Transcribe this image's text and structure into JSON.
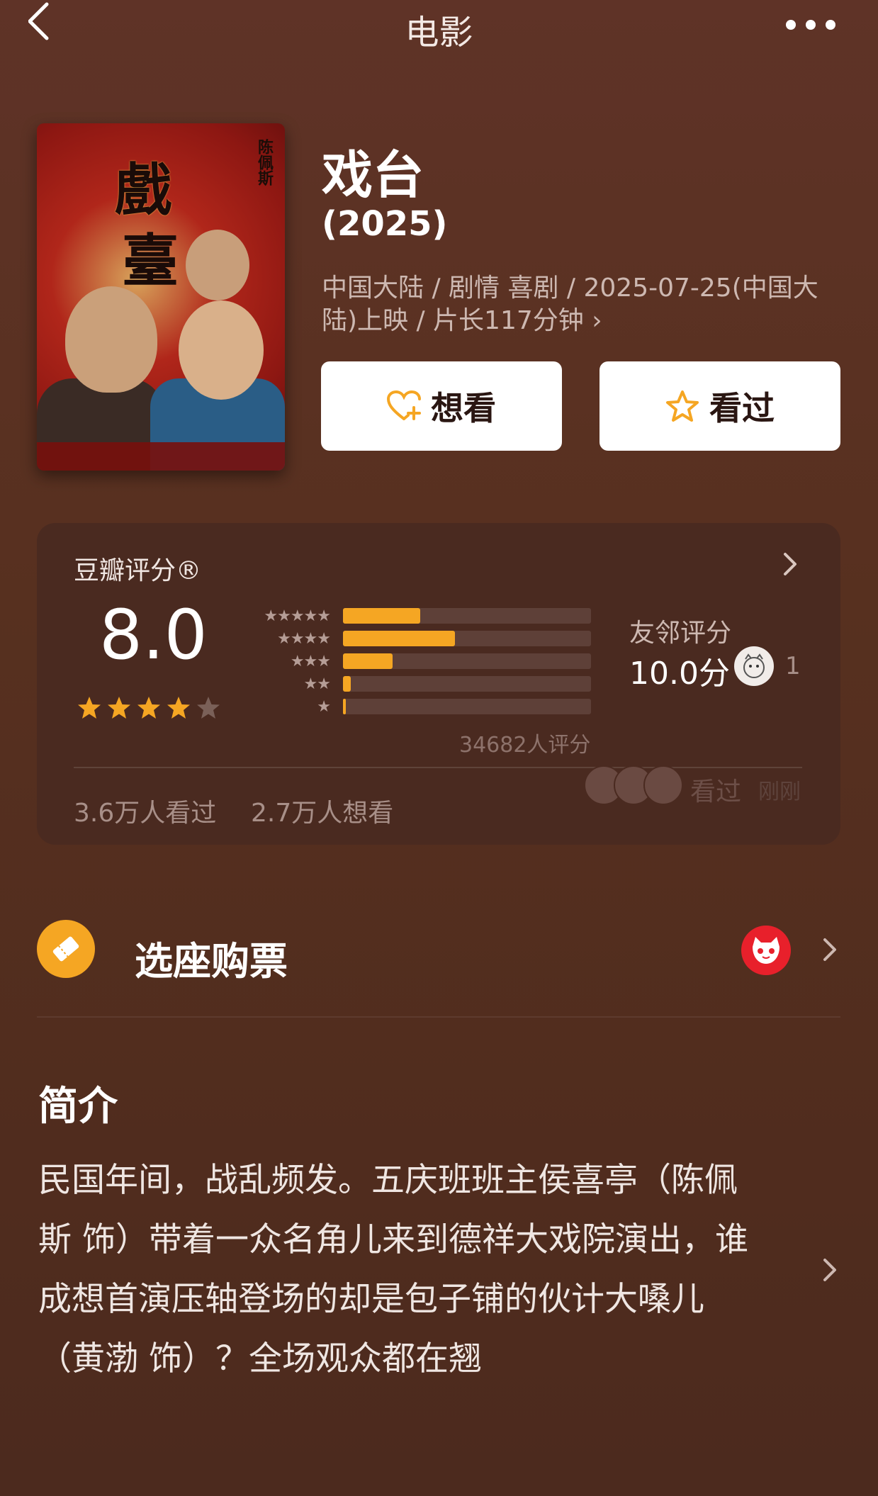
{
  "nav": {
    "title": "电影"
  },
  "poster": {
    "title_line1": "戲",
    "title_line2": "臺",
    "side_text": "陈佩斯"
  },
  "movie": {
    "title": "戏台",
    "year": "(2025)",
    "meta": "中国大陆 / 剧情 喜剧 / 2025-07-25(中国大陆)上映 / 片长117分钟 ›"
  },
  "actions": {
    "want_label": "想看",
    "seen_label": "看过"
  },
  "rating": {
    "label": "豆瓣评分®",
    "score": "8.0",
    "stars_filled": 4,
    "stars_total": 5,
    "distribution": [
      {
        "stars": "★★★★★",
        "fraction": 0.31
      },
      {
        "stars": "★★★★",
        "fraction": 0.45
      },
      {
        "stars": "★★★",
        "fraction": 0.2
      },
      {
        "stars": "★★",
        "fraction": 0.03
      },
      {
        "stars": "★",
        "fraction": 0.01
      }
    ],
    "count_text": "34682人评分",
    "friend_label": "友邻评分",
    "friend_score": "10.0分",
    "friend_count": "1",
    "seen_count": "3.6万人看过",
    "want_count": "2.7万人想看",
    "activity_text": "看过",
    "activity_time": "刚刚"
  },
  "ticket": {
    "label": "选座购票"
  },
  "intro": {
    "heading": "简介",
    "text": "民国年间，战乱频发。五庆班班主侯喜亭（陈佩斯 饰）带着一众名角儿来到德祥大戏院演出，谁成想首演压轴登场的却是包子铺的伙计大嗓儿（黄渤 饰）？全场观众都在翘"
  },
  "colors": {
    "accent": "#f5a623",
    "background": "#57301f",
    "card": "#4a2a20",
    "maoyan_red": "#e8202b"
  }
}
